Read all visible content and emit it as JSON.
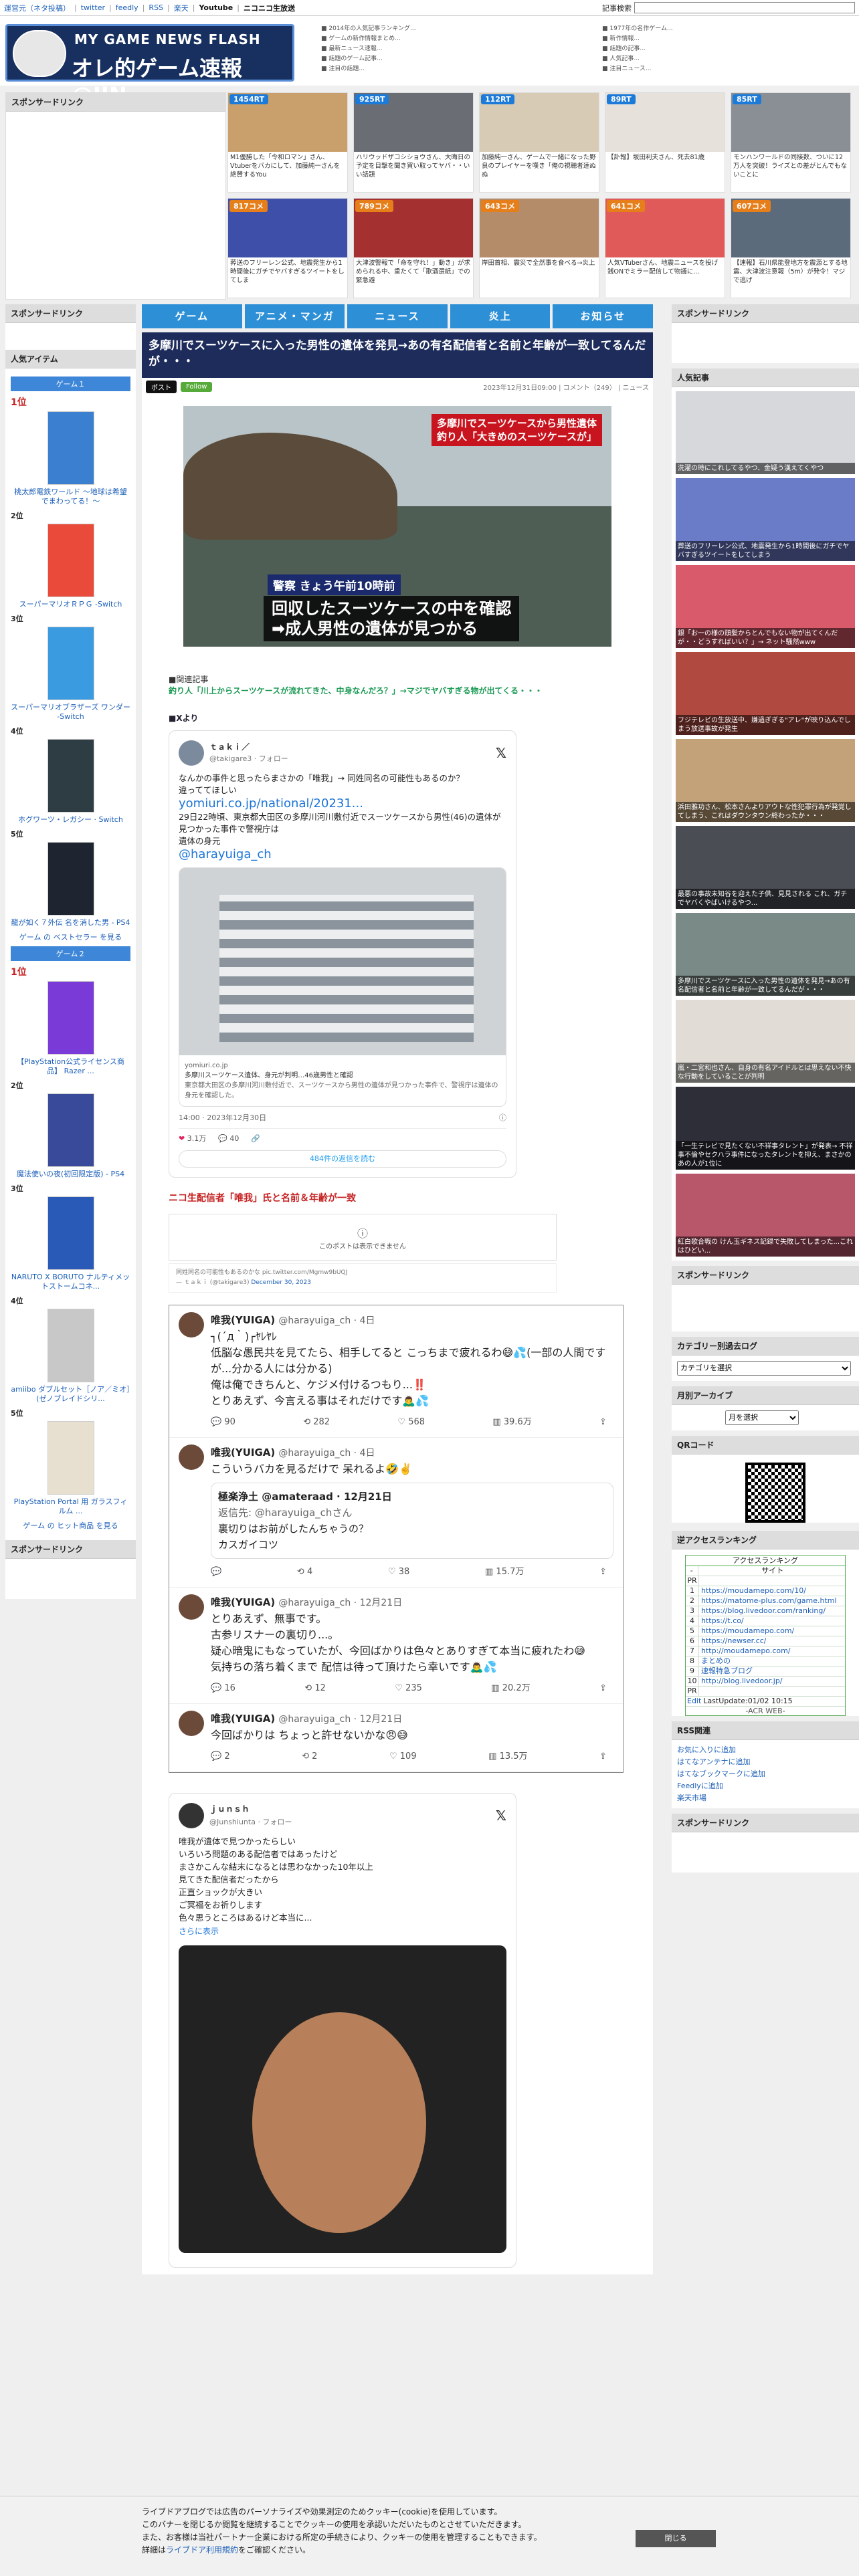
{
  "topbar": {
    "links": [
      "運営元（ネタ投稿）",
      "twitter",
      "feedly",
      "RSS",
      "楽天",
      "Youtube",
      "ニコニコ生放送"
    ],
    "search_label": "記事検索"
  },
  "logo": {
    "sub": "MY GAME NEWS FLASH",
    "main": "オレ的ゲーム速報@JIN"
  },
  "sections": {
    "sponsored": "スポンサードリンク",
    "popular_items": "人気アイテム",
    "popular_articles": "人気記事",
    "category_log": "カテゴリー別過去ログ",
    "monthly_archive": "月別アーカイブ",
    "qr": "QRコード",
    "reverse_ranking": "逆アクセスランキング",
    "rss": "RSS関連"
  },
  "rank_cards": [
    {
      "badge": "1454RT",
      "cm": false,
      "color": "#c9a06b",
      "cap": "M1優勝した「令和ロマン」さん、Vtuberをバカにして、加藤純一さんを絶賛するYou"
    },
    {
      "badge": "925RT",
      "cm": false,
      "color": "#6a6e74",
      "cap": "ハリウッドザコシショウさん、大晦日の予定を目撃を聞き買い取ってヤバ・・いい話題"
    },
    {
      "badge": "112RT",
      "cm": false,
      "color": "#d8cbb5",
      "cap": "加藤純一さん、ゲームで一緒になった野良のプレイヤーを嘆き「俺の視聴者達ぬぬ"
    },
    {
      "badge": "89RT",
      "cm": false,
      "color": "#e6e1db",
      "cap": "【訃報】坂田利夫さん、死去81歳"
    },
    {
      "badge": "85RT",
      "cm": false,
      "color": "#8a8f96",
      "cap": "モンハンワールドの同接数、ついに12万人を突破！ライズとの差がとんでもないことに"
    },
    {
      "badge": "817コメ",
      "cm": true,
      "color": "#3d4fa8",
      "cap": "葬送のフリーレン公式、地震発生から1時間後にガチでヤバすぎるツイートをしてしま"
    },
    {
      "badge": "789コメ",
      "cm": true,
      "color": "#a43030",
      "cap": "大津波警報で「命を守れ！」動き」が求められる中、重たくて「歌酒選紙」での緊急避"
    },
    {
      "badge": "643コメ",
      "cm": true,
      "color": "#b58c6a",
      "cap": "岸田首相、震災で全然事を食べる→炎上"
    },
    {
      "badge": "641コメ",
      "cm": true,
      "color": "#e05a5a",
      "cap": "人気VTuberさん、地震ニュースを投げ銭ONでミラー配信して物議に..."
    },
    {
      "badge": "607コメ",
      "cm": true,
      "color": "#5b6b7b",
      "cap": "【速報】石川県能登地方を震源とする地震、大津波注意報（5m）が発令！マジで逃げ"
    }
  ],
  "nav": [
    "ゲーム",
    "アニメ・マンガ",
    "ニュース",
    "炎上",
    "お知らせ"
  ],
  "article": {
    "title": "多摩川でスーツケースに入った男性の遺体を発見→あの有名配信者と名前と年齢が一致してるんだが・・・",
    "share": "ポスト",
    "follow": "Follow",
    "date": "2023年12月31日09:00",
    "comments": "コメント（249）",
    "category": "ニュース",
    "hero_tag1": "多摩川でスーツケースから男性遺体",
    "hero_tag2": "釣り人「大きめのスーツケースが」",
    "hero_cap1": "警察 きょう午前10時前",
    "hero_cap2a": "回収したスーツケースの中を確認",
    "hero_cap2b": "➡成人男性の遺体が見つかる",
    "related_label": "■関連記事",
    "related_link": "釣り人「川上からスーツケースが流れてきた、中身なんだろ？」→マジでヤバすぎる物が出てくる・・・",
    "xfrom": "■Xより",
    "red_head": "ニコ生配信者「唯我」氏と名前＆年齢が一致"
  },
  "tweet1": {
    "name": "ｔａｋｉ／",
    "handle": "@takigare3 · フォロー",
    "line1": "なんかの事件と思ったらまさかの「唯我」→ 同姓同名の可能性もあるのか？",
    "line2": "違っててほしい",
    "link": "yomiuri.co.jp/national/20231...",
    "line3": "29日22時頃、東京都大田区の多摩川河川敷付近でスーツケースから男性(46)の遺体が見つかった事件で警視庁は",
    "line4": "遺体の身元",
    "mention": "@harayuiga_ch",
    "card_domain": "yomiuri.co.jp",
    "card_title": "多摩川スーツケース遺体、身元が判明…46歳男性と確認",
    "card_desc": "東京都大田区の多摩川河川敷付近で、スーツケースから男性の遺体が見つかった事件で、警視庁は遺体の身元を確認した。",
    "time": "14:00 · 2023年12月30日",
    "likes": "3.1万",
    "replies": "40",
    "reply_btn": "484件の返信を読む"
  },
  "embed": {
    "notice": "このポストは表示できません",
    "src1": "同姓同名の可能性もあるのかな pic.twitter.com/Mgmw9bUQJ",
    "src2": "— ｔａｋｉ (@takigare3)",
    "src2_date": "December 30, 2023"
  },
  "thread": [
    {
      "name": "唯我(YUIGA)",
      "handle": "@harayuiga_ch · 4日",
      "text": "┐(´д｀)┌ﾔﾚﾔﾚ\n低脳な愚民共を見てたら、相手してると こっちまで疲れるわ😅💦(一部の人間ですが...分かる人には分かる)\n俺は俺できちんと、ケジメ付けるつもり...‼️\nとりあえず、今言える事はそれだけです🙇‍♂️💦",
      "quote": null,
      "stats": [
        "90",
        "282",
        "568",
        "39.6万"
      ]
    },
    {
      "name": "唯我(YUIGA)",
      "handle": "@harayuiga_ch · 4日",
      "text": "こういうバカを見るだけで 呆れるよ🤣✌️",
      "quote": {
        "name": "極楽浄土 @amateraad · 12月21日",
        "reply": "返信先: @harayuiga_chさん",
        "text": "裏切りはお前がしたんちゃうの？\nカスガイコツ"
      },
      "stats": [
        "",
        "4",
        "38",
        "15.7万"
      ]
    },
    {
      "name": "唯我(YUIGA)",
      "handle": "@harayuiga_ch · 12月21日",
      "text": "とりあえず、無事です。\n古参リスナーの裏切り...。\n疑心暗鬼にもなっていたが、今回ばかりは色々とありすぎて本当に疲れたわ😅\n気持ちの落ち着くまで 配信は待って頂けたら幸いです🙇‍♂️💦",
      "quote": null,
      "stats": [
        "16",
        "12",
        "235",
        "20.2万"
      ]
    },
    {
      "name": "唯我(YUIGA)",
      "handle": "@harayuiga_ch · 12月21日",
      "text": "今回ばかりは ちょっと許せないかな😠😅",
      "quote": null,
      "stats": [
        "2",
        "2",
        "109",
        "13.5万"
      ]
    }
  ],
  "tweet2": {
    "name": "ｊｕｎｓｈ",
    "handle": "@Junshiunta · フォロー",
    "lines": [
      "唯我が遺体で見つかったらしい",
      "いろいろ問題のある配信者ではあったけど",
      "まさかこんな結末になるとは思わなかった10年以上",
      "見てきた配信者だったから",
      "正直ショックが大きい",
      "ご冥福をお祈りします",
      "色々思うところはあるけど本当に..."
    ],
    "more": "さらに表示"
  },
  "left_items": {
    "game1_label": "ゲーム１",
    "game2_label": "ゲーム２",
    "list1": [
      {
        "rank": "1位",
        "name": "桃太郎電鉄ワールド ～地球は希望でまわってる！～",
        "color": "#3a7fd0"
      },
      {
        "rank": "2位",
        "name": "スーパーマリオＲＰＧ -Switch",
        "color": "#e94a3a"
      },
      {
        "rank": "3位",
        "name": "スーパーマリオブラザーズ ワンダー -Switch",
        "color": "#3b9be0"
      },
      {
        "rank": "4位",
        "name": "ホグワーツ・レガシー · Switch",
        "color": "#2e3c44"
      },
      {
        "rank": "5位",
        "name": "龍が如く７外伝 名を消した男 - PS4",
        "color": "#1e2430"
      }
    ],
    "more1": "ゲーム の ベストセラー を見る",
    "list2": [
      {
        "rank": "1位",
        "name": "【PlayStation公式ライセンス商品】 Razer ...",
        "color": "#7a3ad8"
      },
      {
        "rank": "2位",
        "name": "魔法使いの夜(初回限定版) - PS4",
        "color": "#3a4a9a"
      },
      {
        "rank": "3位",
        "name": "NARUTO X BORUTO ナルティメットストームコネ...",
        "color": "#2a5ab8"
      },
      {
        "rank": "4位",
        "name": "amiibo ダブルセット［ノア／ミオ］(ゼノブレイドシリ...",
        "color": "#c8c8c8"
      },
      {
        "rank": "5位",
        "name": "PlayStation Portal 用 ガラスフィルム ...",
        "color": "#e7e0d0"
      }
    ],
    "more2": "ゲーム の ヒット商品 を見る"
  },
  "popular": [
    {
      "cap": "洗濯の時にこれしてるやつ、金疑う漢えてくやつ",
      "color": "#d6d8dc"
    },
    {
      "cap": "葬送のフリーレン公式、地震発生から1時間後にガチでヤバすぎるツイートをしてしまう",
      "color": "#6a7bc8"
    },
    {
      "cap": "銀「お一の様の頭髪からとんでもない物が出てくんだが・・どうすればいい？」→ ネット騒然www",
      "color": "#d95a6a"
    },
    {
      "cap": "フジテレビの生放送中、嫌過ぎぎる\"アレ\"が映り込んでしまう放送事故が発生",
      "color": "#b04a40"
    },
    {
      "cap": "浜田雅功さん、松本さんよりアウトな性犯罪行為が発覚してしまう、これはダウンタウン終わったか・・・",
      "color": "#c3a27a"
    },
    {
      "cap": "最悪の事故未知谷を迎えた子供、見見される これ、ガチでヤバくやばいけるやつ...",
      "color": "#4a4e54"
    },
    {
      "cap": "多摩川でスーツケースに入った男性の遺体を発見→あの有名配信者と名前と年齢が一致してるんだが・・・",
      "color": "#7a8a86"
    },
    {
      "cap": "嵐・二宮和也さん、自身の有名アイドルとは思えない不快な行動をしていることが判明",
      "color": "#e1ddd6"
    },
    {
      "cap": "「一生テレビで見たくない不祥事タレント」が発表→ 不祥事不倫やセクハラ事件になったタレントを抑え、まさかのあの人が1位に",
      "color": "#2e2e38"
    },
    {
      "cap": "紅白歌合戦の けん玉ギネス記録で失敗してしまった...これはひどい...",
      "color": "#b8566a"
    }
  ],
  "selects": {
    "category": "カテゴリを選択",
    "month": "月を選択"
  },
  "access_ranking": {
    "title": "アクセスランキング",
    "site_label": "サイト",
    "pr": "PR",
    "rows": [
      "https://moudamepo.com/10/",
      "https://matome-plus.com/game.html",
      "https://blog.livedoor.com/ranking/",
      "https://t.co/",
      "https://moudamepo.com/",
      "https://newser.cc/",
      "http://moudamepo.com/",
      "まとめの",
      "速報特急ブログ",
      "http://blog.livedoor.jp/"
    ],
    "edit": "Edit",
    "update": "LastUpdate:01/02 10:15",
    "footer": "-ACR WEB-"
  },
  "rss": [
    "お気に入りに追加",
    "はてなアンテナに追加",
    "はてなブックマークに追加",
    "Feedlyに追加",
    "楽天市場"
  ],
  "cookie": {
    "line1": "ライブドアブログでは広告のパーソナライズや効果測定のためクッキー(cookie)を使用しています。",
    "line2": "このバナーを閉じるか閲覧を継続することでクッキーの使用を承認いただいたものとさせていただきます。",
    "line3": "また、お客様は当社パートナー企業における所定の手続きにより、クッキーの使用を管理することもできます。",
    "line4_pre": "詳細は",
    "line4_link": "ライブドア利用規約",
    "line4_post": "をご確認ください。",
    "close": "閉じる"
  }
}
